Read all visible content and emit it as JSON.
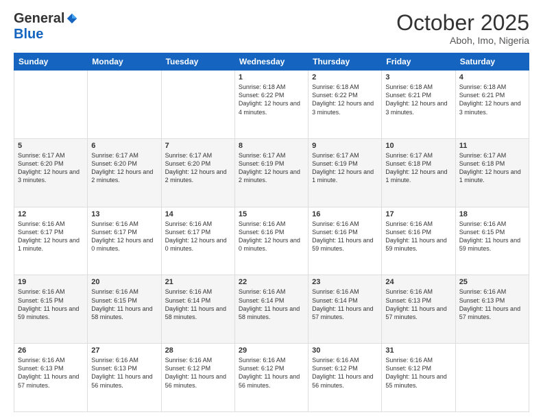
{
  "header": {
    "logo": {
      "general": "General",
      "blue": "Blue"
    },
    "title": "October 2025",
    "subtitle": "Aboh, Imo, Nigeria"
  },
  "days_of_week": [
    "Sunday",
    "Monday",
    "Tuesday",
    "Wednesday",
    "Thursday",
    "Friday",
    "Saturday"
  ],
  "weeks": [
    [
      {
        "day": "",
        "info": ""
      },
      {
        "day": "",
        "info": ""
      },
      {
        "day": "",
        "info": ""
      },
      {
        "day": "1",
        "info": "Sunrise: 6:18 AM\nSunset: 6:22 PM\nDaylight: 12 hours and 4 minutes."
      },
      {
        "day": "2",
        "info": "Sunrise: 6:18 AM\nSunset: 6:22 PM\nDaylight: 12 hours and 3 minutes."
      },
      {
        "day": "3",
        "info": "Sunrise: 6:18 AM\nSunset: 6:21 PM\nDaylight: 12 hours and 3 minutes."
      },
      {
        "day": "4",
        "info": "Sunrise: 6:18 AM\nSunset: 6:21 PM\nDaylight: 12 hours and 3 minutes."
      }
    ],
    [
      {
        "day": "5",
        "info": "Sunrise: 6:17 AM\nSunset: 6:20 PM\nDaylight: 12 hours and 3 minutes."
      },
      {
        "day": "6",
        "info": "Sunrise: 6:17 AM\nSunset: 6:20 PM\nDaylight: 12 hours and 2 minutes."
      },
      {
        "day": "7",
        "info": "Sunrise: 6:17 AM\nSunset: 6:20 PM\nDaylight: 12 hours and 2 minutes."
      },
      {
        "day": "8",
        "info": "Sunrise: 6:17 AM\nSunset: 6:19 PM\nDaylight: 12 hours and 2 minutes."
      },
      {
        "day": "9",
        "info": "Sunrise: 6:17 AM\nSunset: 6:19 PM\nDaylight: 12 hours and 1 minute."
      },
      {
        "day": "10",
        "info": "Sunrise: 6:17 AM\nSunset: 6:18 PM\nDaylight: 12 hours and 1 minute."
      },
      {
        "day": "11",
        "info": "Sunrise: 6:17 AM\nSunset: 6:18 PM\nDaylight: 12 hours and 1 minute."
      }
    ],
    [
      {
        "day": "12",
        "info": "Sunrise: 6:16 AM\nSunset: 6:17 PM\nDaylight: 12 hours and 1 minute."
      },
      {
        "day": "13",
        "info": "Sunrise: 6:16 AM\nSunset: 6:17 PM\nDaylight: 12 hours and 0 minutes."
      },
      {
        "day": "14",
        "info": "Sunrise: 6:16 AM\nSunset: 6:17 PM\nDaylight: 12 hours and 0 minutes."
      },
      {
        "day": "15",
        "info": "Sunrise: 6:16 AM\nSunset: 6:16 PM\nDaylight: 12 hours and 0 minutes."
      },
      {
        "day": "16",
        "info": "Sunrise: 6:16 AM\nSunset: 6:16 PM\nDaylight: 11 hours and 59 minutes."
      },
      {
        "day": "17",
        "info": "Sunrise: 6:16 AM\nSunset: 6:16 PM\nDaylight: 11 hours and 59 minutes."
      },
      {
        "day": "18",
        "info": "Sunrise: 6:16 AM\nSunset: 6:15 PM\nDaylight: 11 hours and 59 minutes."
      }
    ],
    [
      {
        "day": "19",
        "info": "Sunrise: 6:16 AM\nSunset: 6:15 PM\nDaylight: 11 hours and 59 minutes."
      },
      {
        "day": "20",
        "info": "Sunrise: 6:16 AM\nSunset: 6:15 PM\nDaylight: 11 hours and 58 minutes."
      },
      {
        "day": "21",
        "info": "Sunrise: 6:16 AM\nSunset: 6:14 PM\nDaylight: 11 hours and 58 minutes."
      },
      {
        "day": "22",
        "info": "Sunrise: 6:16 AM\nSunset: 6:14 PM\nDaylight: 11 hours and 58 minutes."
      },
      {
        "day": "23",
        "info": "Sunrise: 6:16 AM\nSunset: 6:14 PM\nDaylight: 11 hours and 57 minutes."
      },
      {
        "day": "24",
        "info": "Sunrise: 6:16 AM\nSunset: 6:13 PM\nDaylight: 11 hours and 57 minutes."
      },
      {
        "day": "25",
        "info": "Sunrise: 6:16 AM\nSunset: 6:13 PM\nDaylight: 11 hours and 57 minutes."
      }
    ],
    [
      {
        "day": "26",
        "info": "Sunrise: 6:16 AM\nSunset: 6:13 PM\nDaylight: 11 hours and 57 minutes."
      },
      {
        "day": "27",
        "info": "Sunrise: 6:16 AM\nSunset: 6:13 PM\nDaylight: 11 hours and 56 minutes."
      },
      {
        "day": "28",
        "info": "Sunrise: 6:16 AM\nSunset: 6:12 PM\nDaylight: 11 hours and 56 minutes."
      },
      {
        "day": "29",
        "info": "Sunrise: 6:16 AM\nSunset: 6:12 PM\nDaylight: 11 hours and 56 minutes."
      },
      {
        "day": "30",
        "info": "Sunrise: 6:16 AM\nSunset: 6:12 PM\nDaylight: 11 hours and 56 minutes."
      },
      {
        "day": "31",
        "info": "Sunrise: 6:16 AM\nSunset: 6:12 PM\nDaylight: 11 hours and 55 minutes."
      },
      {
        "day": "",
        "info": ""
      }
    ]
  ]
}
